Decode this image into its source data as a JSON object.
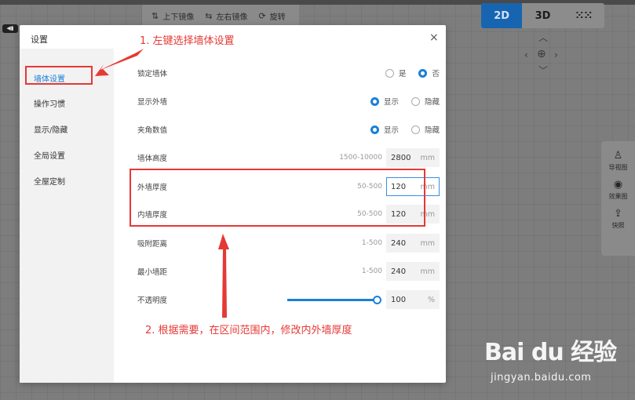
{
  "toolbar": {
    "items": [
      {
        "icon": "flip-vertical-icon",
        "label": "上下镜像"
      },
      {
        "icon": "flip-horizontal-icon",
        "label": "左右镜像"
      },
      {
        "icon": "rotate-icon",
        "label": "旋转"
      }
    ]
  },
  "view_toggle": {
    "items": [
      "2D",
      "3D"
    ],
    "active": "2D"
  },
  "side_tools": [
    {
      "icon": "person-icon",
      "label": "导视图"
    },
    {
      "icon": "camera-icon",
      "label": "效果图"
    },
    {
      "icon": "snapshot-icon",
      "label": "快照"
    }
  ],
  "left_tab": "◀▮",
  "dialog": {
    "title": "设置",
    "close": "×",
    "sidebar": [
      "墙体设置",
      "操作习惯",
      "显示/隐藏",
      "全局设置",
      "全屋定制"
    ],
    "active_sidebar": "墙体设置",
    "rows": {
      "lock_wall": {
        "label": "锁定墙体",
        "options": [
          "是",
          "否"
        ],
        "selected": "否"
      },
      "show_outer": {
        "label": "显示外墙",
        "options": [
          "显示",
          "隐藏"
        ],
        "selected": "显示"
      },
      "angle_value": {
        "label": "夹角数值",
        "options": [
          "显示",
          "隐藏"
        ],
        "selected": "显示"
      },
      "wall_height": {
        "label": "墙体高度",
        "range": "1500-10000",
        "value": "2800",
        "unit": "mm"
      },
      "outer_thickness": {
        "label": "外墙厚度",
        "range": "50-500",
        "value": "120",
        "unit": "mm"
      },
      "inner_thickness": {
        "label": "内墙厚度",
        "range": "50-500",
        "value": "120",
        "unit": "mm"
      },
      "snap_distance": {
        "label": "吸附距离",
        "range": "1-500",
        "value": "240",
        "unit": "mm"
      },
      "min_spacing": {
        "label": "最小墙距",
        "range": "1-500",
        "value": "240",
        "unit": "mm"
      },
      "opacity": {
        "label": "不透明度",
        "value": "100",
        "unit": "%",
        "level_percent": 100
      }
    }
  },
  "annotations": {
    "step1": "1. 左键选择墙体设置",
    "step2": "2. 根据需要，在区间范围内，修改内外墙厚度"
  },
  "watermark": {
    "logo": "Bai du 经验",
    "url": "jingyan.baidu.com"
  },
  "colors": {
    "accent": "#1a7fd9",
    "annotation_red": "#e53935",
    "view_active": "#1765b1"
  }
}
